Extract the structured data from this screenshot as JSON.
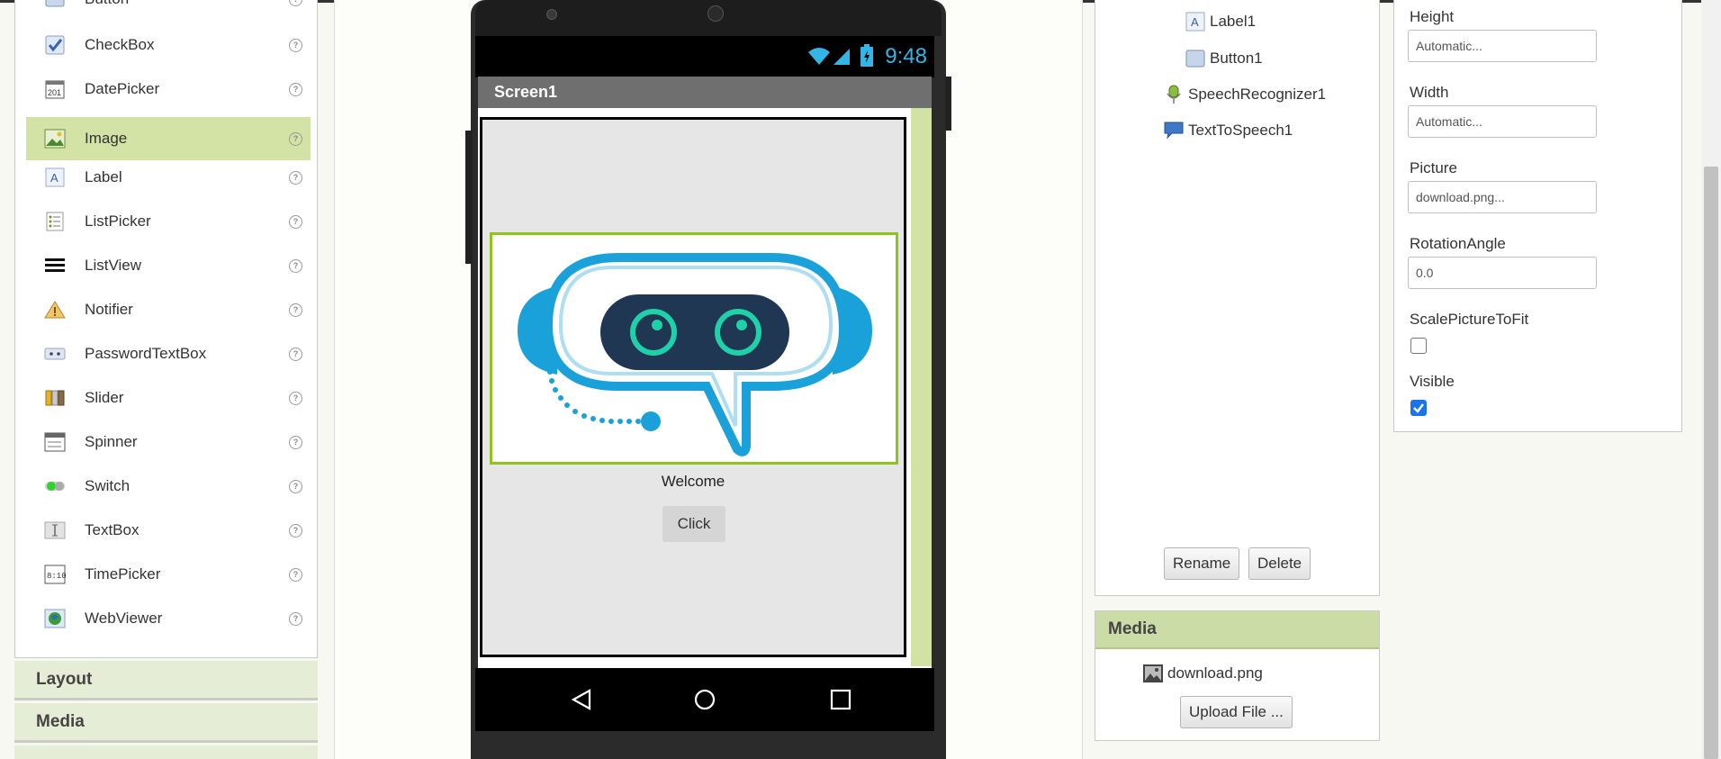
{
  "palette": {
    "items": [
      {
        "label": "Button",
        "icon": "button-icon"
      },
      {
        "label": "CheckBox",
        "icon": "checkbox-icon"
      },
      {
        "label": "DatePicker",
        "icon": "datepicker-icon"
      },
      {
        "label": "Image",
        "icon": "image-icon",
        "selected": true
      },
      {
        "label": "Label",
        "icon": "label-icon"
      },
      {
        "label": "ListPicker",
        "icon": "listpicker-icon"
      },
      {
        "label": "ListView",
        "icon": "listview-icon"
      },
      {
        "label": "Notifier",
        "icon": "notifier-icon"
      },
      {
        "label": "PasswordTextBox",
        "icon": "password-icon"
      },
      {
        "label": "Slider",
        "icon": "slider-icon"
      },
      {
        "label": "Spinner",
        "icon": "spinner-icon"
      },
      {
        "label": "Switch",
        "icon": "switch-icon"
      },
      {
        "label": "TextBox",
        "icon": "textbox-icon"
      },
      {
        "label": "TimePicker",
        "icon": "timepicker-icon"
      },
      {
        "label": "WebViewer",
        "icon": "webviewer-icon"
      }
    ],
    "help_glyph": "?",
    "sections": [
      "Layout",
      "Media"
    ]
  },
  "viewer": {
    "clock": "9:48",
    "screen_title": "Screen1",
    "label_text": "Welcome",
    "button_text": "Click"
  },
  "components": {
    "items": [
      {
        "label": "Label1",
        "icon": "label-icon"
      },
      {
        "label": "Button1",
        "icon": "button-icon"
      },
      {
        "label": "SpeechRecognizer1",
        "icon": "speech-recognizer-icon"
      },
      {
        "label": "TextToSpeech1",
        "icon": "text-to-speech-icon"
      }
    ],
    "rename_label": "Rename",
    "delete_label": "Delete"
  },
  "media": {
    "title": "Media",
    "file": "download.png",
    "upload_label": "Upload File ..."
  },
  "properties": {
    "height_label": "Height",
    "height_value": "Automatic...",
    "width_label": "Width",
    "width_value": "Automatic...",
    "picture_label": "Picture",
    "picture_value": "download.png...",
    "rotation_label": "RotationAngle",
    "rotation_value": "0.0",
    "scale_label": "ScalePictureToFit",
    "scale_checked": false,
    "visible_label": "Visible",
    "visible_checked": true
  },
  "colors": {
    "selected_row": "#d3e3a5",
    "header_green": "#ccdca6",
    "image_border": "#8fc31f",
    "clock_blue": "#33b5e5"
  }
}
